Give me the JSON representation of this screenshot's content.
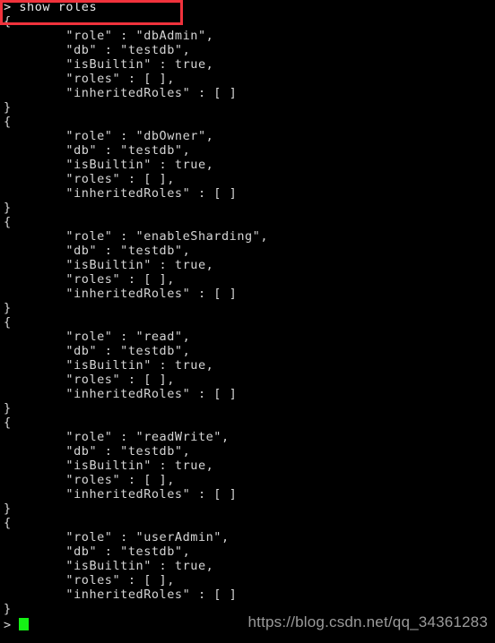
{
  "terminal": {
    "background_color": "#000000",
    "text_color": "#d6d6d6",
    "prompt_symbol": ">",
    "command_line": "> show roles",
    "bottom_prompt": ">",
    "cursor_color": "#15f215"
  },
  "annotation": {
    "box_color": "#f0323c",
    "shape": "rectangle-outline"
  },
  "watermark": {
    "text": "https://blog.csdn.net/qq_34361283",
    "color": "#9a9a9a"
  },
  "output": {
    "lines": [
      "> show roles",
      "{",
      "        \"role\" : \"dbAdmin\",",
      "        \"db\" : \"testdb\",",
      "        \"isBuiltin\" : true,",
      "        \"roles\" : [ ],",
      "        \"inheritedRoles\" : [ ]",
      "}",
      "{",
      "        \"role\" : \"dbOwner\",",
      "        \"db\" : \"testdb\",",
      "        \"isBuiltin\" : true,",
      "        \"roles\" : [ ],",
      "        \"inheritedRoles\" : [ ]",
      "}",
      "{",
      "        \"role\" : \"enableSharding\",",
      "        \"db\" : \"testdb\",",
      "        \"isBuiltin\" : true,",
      "        \"roles\" : [ ],",
      "        \"inheritedRoles\" : [ ]",
      "}",
      "{",
      "        \"role\" : \"read\",",
      "        \"db\" : \"testdb\",",
      "        \"isBuiltin\" : true,",
      "        \"roles\" : [ ],",
      "        \"inheritedRoles\" : [ ]",
      "}",
      "{",
      "        \"role\" : \"readWrite\",",
      "        \"db\" : \"testdb\",",
      "        \"isBuiltin\" : true,",
      "        \"roles\" : [ ],",
      "        \"inheritedRoles\" : [ ]",
      "}",
      "{",
      "        \"role\" : \"userAdmin\",",
      "        \"db\" : \"testdb\",",
      "        \"isBuiltin\" : true,",
      "        \"roles\" : [ ],",
      "        \"inheritedRoles\" : [ ]",
      "}"
    ],
    "roles": [
      {
        "role": "dbAdmin",
        "db": "testdb",
        "isBuiltin": "true",
        "roles": "[ ]",
        "inheritedRoles": "[ ]"
      },
      {
        "role": "dbOwner",
        "db": "testdb",
        "isBuiltin": "true",
        "roles": "[ ]",
        "inheritedRoles": "[ ]"
      },
      {
        "role": "enableSharding",
        "db": "testdb",
        "isBuiltin": "true",
        "roles": "[ ]",
        "inheritedRoles": "[ ]"
      },
      {
        "role": "read",
        "db": "testdb",
        "isBuiltin": "true",
        "roles": "[ ]",
        "inheritedRoles": "[ ]"
      },
      {
        "role": "readWrite",
        "db": "testdb",
        "isBuiltin": "true",
        "roles": "[ ]",
        "inheritedRoles": "[ ]"
      },
      {
        "role": "userAdmin",
        "db": "testdb",
        "isBuiltin": "true",
        "roles": "[ ]",
        "inheritedRoles": "[ ]"
      }
    ]
  }
}
